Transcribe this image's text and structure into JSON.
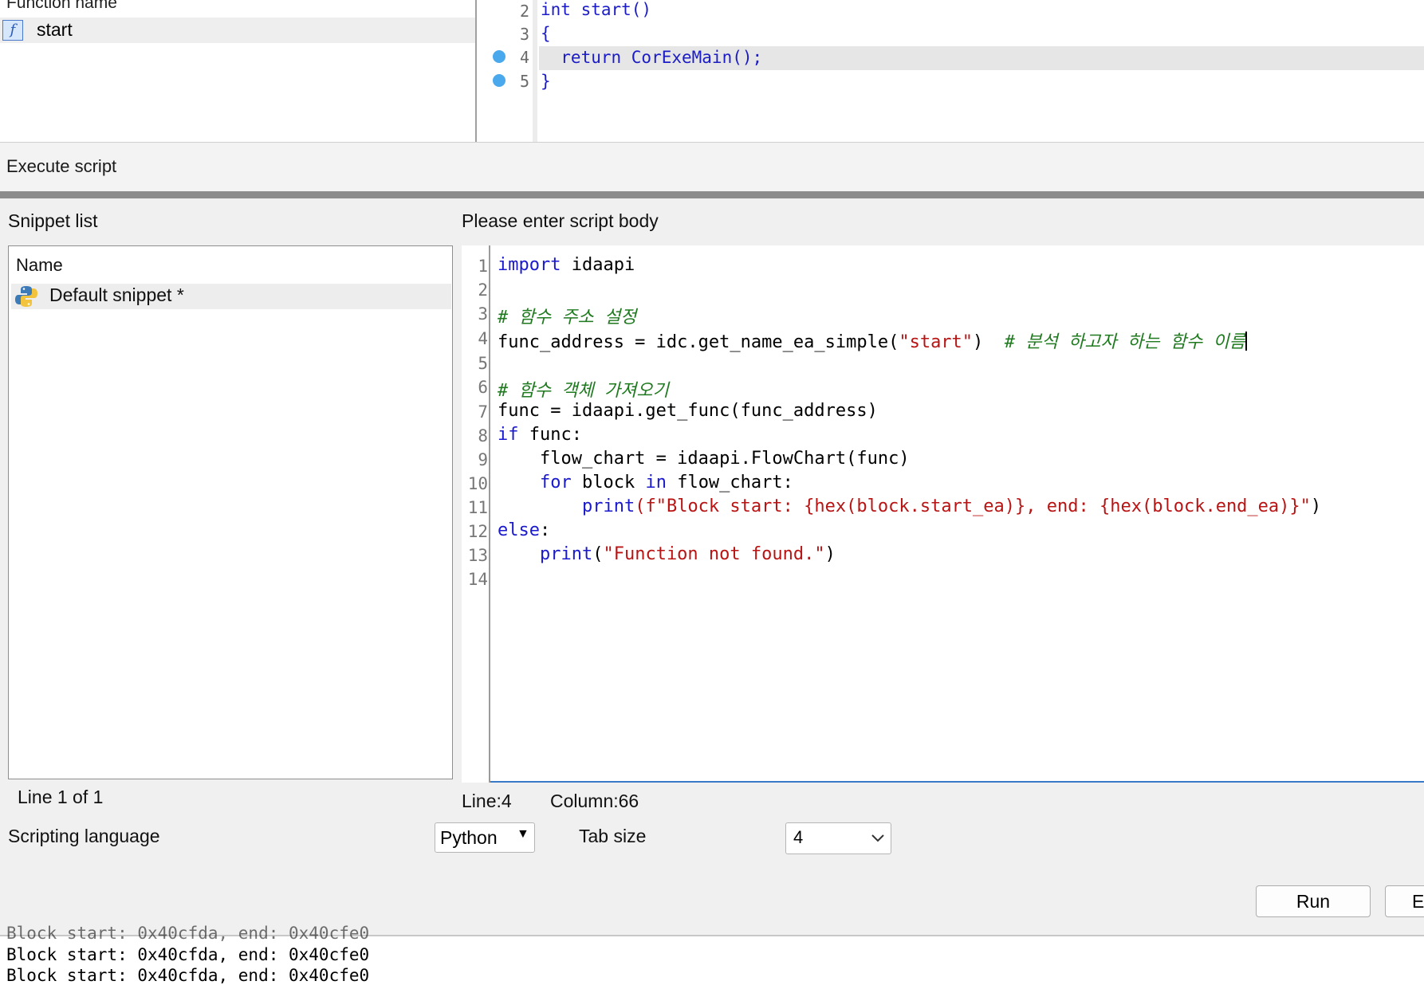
{
  "functions_pane": {
    "header": "Function name",
    "items": [
      {
        "name": "start",
        "icon": "function-icon"
      }
    ]
  },
  "pseudocode": {
    "lines": [
      {
        "num": "2",
        "text": "int start()",
        "breakpoint": false
      },
      {
        "num": "3",
        "text": "{",
        "breakpoint": false
      },
      {
        "num": "4",
        "text": "  return CorExeMain();",
        "breakpoint": true
      },
      {
        "num": "5",
        "text": "}",
        "breakpoint": true
      }
    ]
  },
  "dialog": {
    "title": "Execute script",
    "snippet_list_label": "Snippet list",
    "snippet_column_header": "Name",
    "snippets": [
      {
        "name": "Default snippet *",
        "icon": "python-icon"
      }
    ],
    "snippet_status": "Line 1 of 1",
    "script_body_label": "Please enter script body",
    "cursor_line": "Line:4",
    "cursor_column": "Column:66",
    "scripting_language_label": "Scripting language",
    "scripting_language_value": "Python",
    "tab_size_label": "Tab size",
    "tab_size_value": "4",
    "run_button": "Run",
    "partial_button": "E"
  },
  "script": {
    "line_numbers": [
      "1",
      "2",
      "3",
      "4",
      "5",
      "6",
      "7",
      "8",
      "9",
      "10",
      "11",
      "12",
      "13",
      "14"
    ],
    "lines": {
      "l1_kw": "import",
      "l1_rest": " idaapi",
      "l3_cm": "# 함수 주소 설정",
      "l4_code": "func_address = idc.get_name_ea_simple(",
      "l4_str": "\"start\"",
      "l4_close": ")  ",
      "l4_cm": "# 분석 하고자 하는 함수 이름",
      "l6_cm": "# 함수 객체 가져오기",
      "l7_code": "func = idaapi.get_func(func_address)",
      "l8_kw": "if",
      "l8_rest": " func:",
      "l9_code": "    flow_chart = idaapi.FlowChart(func)",
      "l10_indent": "    ",
      "l10_kw1": "for",
      "l10_mid": " block ",
      "l10_kw2": "in",
      "l10_rest": " flow_chart:",
      "l11_indent": "        ",
      "l11_kw": "print",
      "l11_open": "(f",
      "l11_str": "\"Block start: {hex(block.start_ea)}, end: {hex(block.end_ea)}\"",
      "l11_close": ")",
      "l12_kw": "else",
      "l12_rest": ":",
      "l13_indent": "    ",
      "l13_kw": "print",
      "l13_open": "(",
      "l13_str": "\"Function not found.\"",
      "l13_close": ")"
    }
  },
  "output": {
    "lines": [
      "Block start: 0x40cfda, end: 0x40cfe0",
      "Block start: 0x40cfda, end: 0x40cfe0",
      "Block start: 0x40cfda, end: 0x40cfe0"
    ]
  },
  "colors": {
    "keyword": "#1a1acc",
    "string": "#b81414",
    "comment": "#1f7a1f",
    "breakpoint": "#4aa8ec",
    "editor_focus_border": "#3a78c8"
  }
}
